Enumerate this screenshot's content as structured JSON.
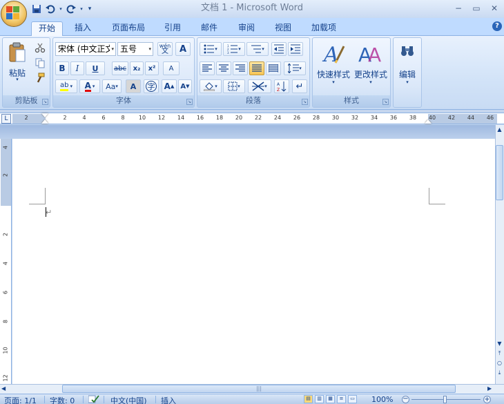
{
  "window": {
    "title": "文档 1 - Microsoft Word",
    "minimize": "−",
    "restore": "▭",
    "close": "✕"
  },
  "qat": {
    "save": "save-icon",
    "undo": "undo-icon",
    "redo": "redo-icon",
    "customize": "▾"
  },
  "tabs": [
    {
      "label": "开始",
      "active": true
    },
    {
      "label": "插入"
    },
    {
      "label": "页面布局"
    },
    {
      "label": "引用"
    },
    {
      "label": "邮件"
    },
    {
      "label": "审阅"
    },
    {
      "label": "视图"
    },
    {
      "label": "加载项"
    }
  ],
  "help": "?",
  "ribbon": {
    "clipboard": {
      "label": "剪贴板",
      "paste_label": "粘贴"
    },
    "font": {
      "label": "字体",
      "font_name": "宋体 (中文正文",
      "font_size": "五号",
      "phonetic": "wén",
      "bold": "B",
      "italic": "I",
      "underline": "U",
      "strike": "abc",
      "sub": "x₂",
      "sup": "x²",
      "clear": "A",
      "change_case": "Aa",
      "char_shade": "A",
      "enclose": "字",
      "grow": "A",
      "shrink": "A",
      "border": "A"
    },
    "paragraph": {
      "label": "段落"
    },
    "styles": {
      "label": "样式",
      "quick_styles": "快速样式",
      "change_styles": "更改样式"
    },
    "editing": {
      "label": "编辑"
    }
  },
  "ruler": {
    "corner": "L",
    "ticks": [
      "2",
      "2",
      "4",
      "6",
      "8",
      "10",
      "12",
      "14",
      "16",
      "18",
      "20",
      "22",
      "24",
      "26",
      "28",
      "30",
      "32",
      "34",
      "36",
      "38",
      "40",
      "42",
      "44",
      "46"
    ]
  },
  "vruler": {
    "ticks": [
      "4",
      "2",
      "2",
      "4",
      "6",
      "8",
      "10",
      "12"
    ]
  },
  "document": {
    "paragraph_mark": "↵"
  },
  "statusbar": {
    "page": "页面: 1/1",
    "words": "字数: 0",
    "language": "中文(中国)",
    "mode": "插入",
    "zoom": "100%"
  },
  "colors": {
    "accent": "#15428b",
    "ribbon_bg": "#dbe8f9",
    "highlight": "#f7c556"
  }
}
